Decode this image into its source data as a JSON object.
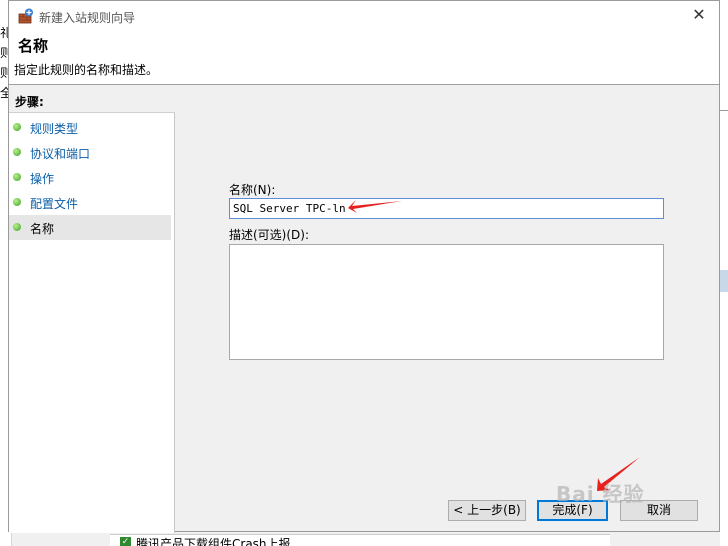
{
  "window": {
    "title": "新建入站规则向导",
    "close_glyph": "✕"
  },
  "header": {
    "title": "名称",
    "subtitle": "指定此规则的名称和描述。"
  },
  "steps": {
    "heading": "步骤:",
    "items": [
      {
        "label": "规则类型"
      },
      {
        "label": "协议和端口"
      },
      {
        "label": "操作"
      },
      {
        "label": "配置文件"
      },
      {
        "label": "名称"
      }
    ],
    "active_index": 4
  },
  "form": {
    "name_label": "名称(N):",
    "name_value": "SQL Server TPC-ln",
    "description_label": "描述(可选)(D):",
    "description_value": ""
  },
  "buttons": {
    "back": "< 上一步(B)",
    "finish": "完成(F)",
    "cancel": "取消"
  },
  "background": {
    "left_fragments": [
      "礼",
      "则",
      "则",
      "全"
    ],
    "bottom_text": "腾讯产品下载组件Crash上报",
    "watermark": "Bai 经验"
  },
  "colors": {
    "accent": "#0078d7",
    "link": "#0b5ea8",
    "arrow": "#e8201e"
  },
  "icons": {
    "app": "firewall-rule-icon",
    "step": "green-bullet-icon",
    "close": "close-icon"
  }
}
